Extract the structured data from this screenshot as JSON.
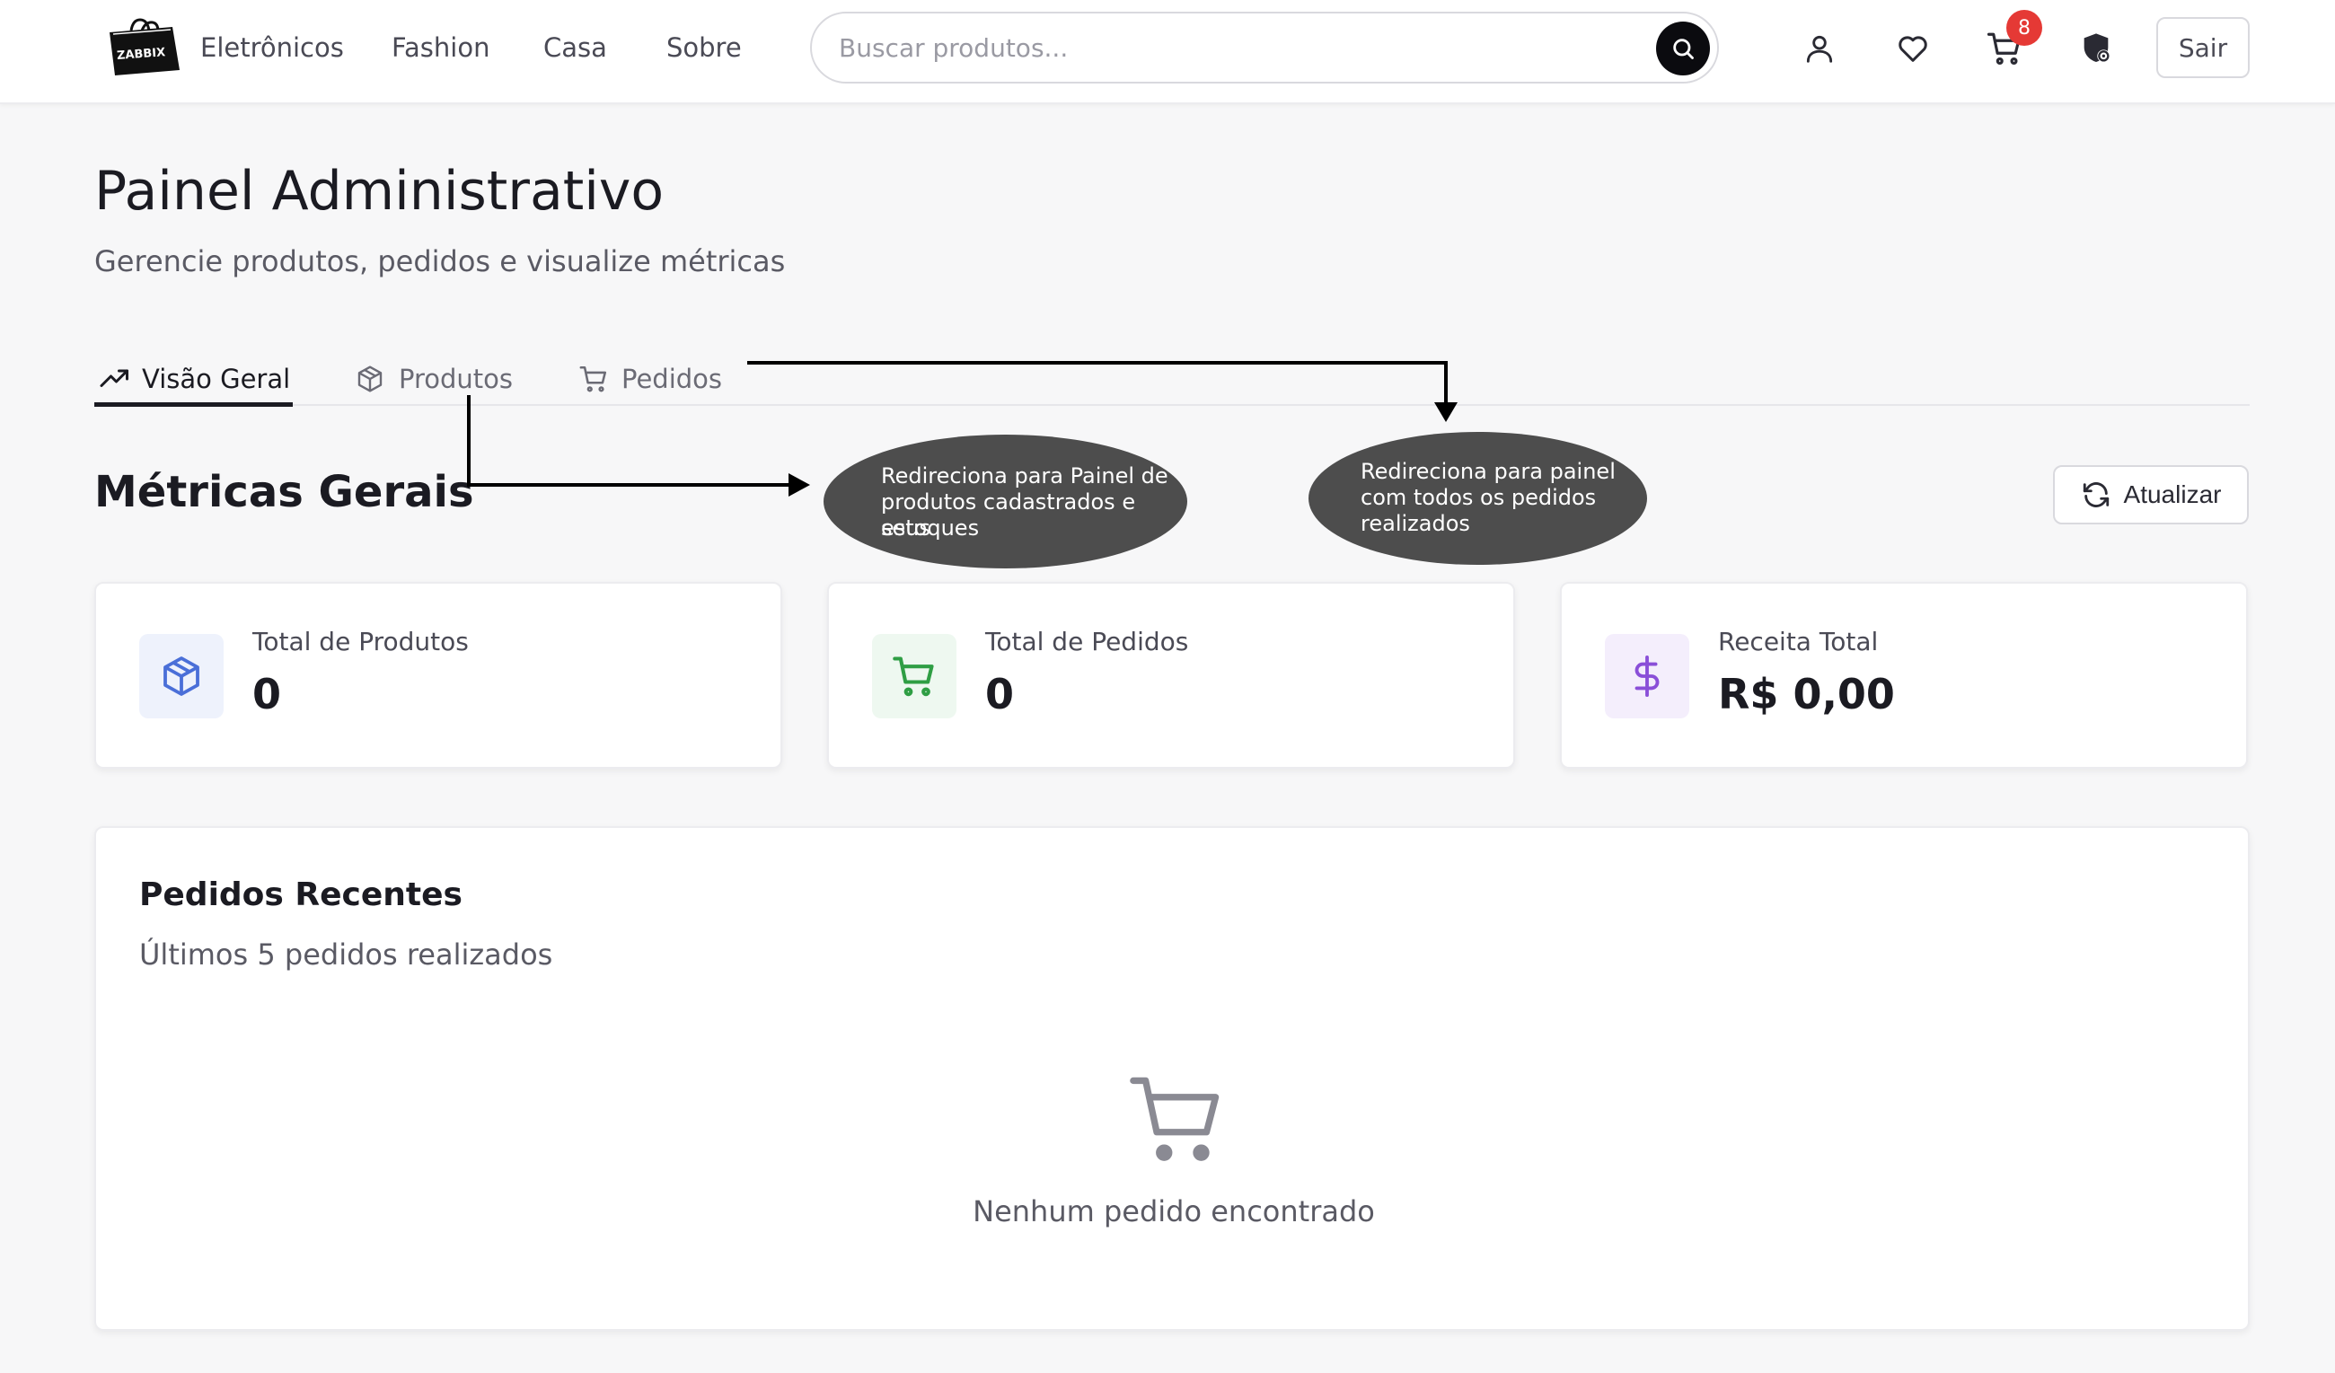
{
  "header": {
    "logo_text": "ZABBIX",
    "nav": [
      "Eletrônicos",
      "Fashion",
      "Casa",
      "Sobre"
    ],
    "search_placeholder": "Buscar produtos...",
    "cart_count": "8",
    "logout_label": "Sair",
    "icons": [
      "user-icon",
      "heart-icon",
      "cart-icon",
      "admin-shield-icon"
    ]
  },
  "page": {
    "title": "Painel Administrativo",
    "subtitle": "Gerencie produtos, pedidos e visualize métricas"
  },
  "tabs": [
    {
      "label": "Visão Geral",
      "icon": "trending-up-icon",
      "active": true
    },
    {
      "label": "Produtos",
      "icon": "package-icon",
      "active": false
    },
    {
      "label": "Pedidos",
      "icon": "cart-icon",
      "active": false
    }
  ],
  "metrics": {
    "section_title": "Métricas Gerais",
    "refresh_label": "Atualizar",
    "cards": [
      {
        "label": "Total de Produtos",
        "value": "0",
        "icon": "package-icon",
        "color": "#4a6fd8",
        "tile_bg": "#eef2fc"
      },
      {
        "label": "Total de Pedidos",
        "value": "0",
        "icon": "cart-icon",
        "color": "#2f9e44",
        "tile_bg": "#eef8f0"
      },
      {
        "label": "Receita Total",
        "value": "R$ 0,00",
        "icon": "dollar-icon",
        "color": "#8a4fd8",
        "tile_bg": "#f4eefc"
      }
    ]
  },
  "recent_orders": {
    "title": "Pedidos Recentes",
    "subtitle": "Últimos 5 pedidos realizados",
    "empty_text": "Nenhum pedido encontrado"
  },
  "annotations": {
    "products": [
      "Redireciona para Painel de",
      "produtos cadastrados e seus",
      "estoques"
    ],
    "orders": [
      "Redireciona para painel",
      "com todos os pedidos",
      "realizados"
    ]
  },
  "colors": {
    "badge": "#e53935",
    "bubble": "#4d4d4d",
    "text_primary": "#1b1b22"
  }
}
